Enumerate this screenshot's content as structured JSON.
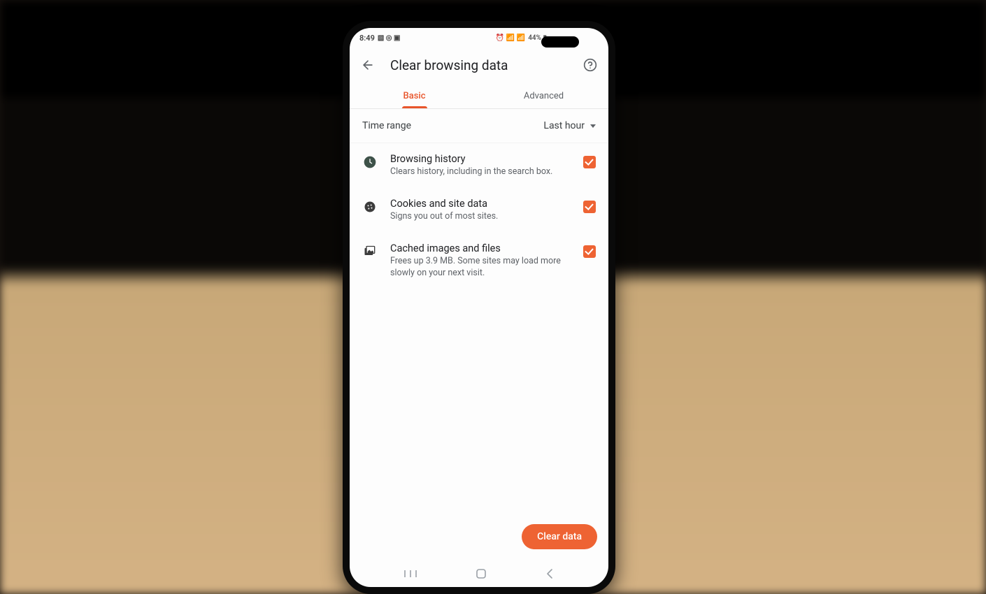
{
  "status": {
    "time": "8:49",
    "left_glyphs": "▧ ◎ ▣",
    "right_glyphs": "⏰ 📶 📶",
    "battery": "44% ▮"
  },
  "appbar": {
    "title": "Clear browsing data"
  },
  "tabs": {
    "basic": "Basic",
    "advanced": "Advanced"
  },
  "time_range": {
    "label": "Time range",
    "value": "Last hour"
  },
  "options": [
    {
      "icon": "clock-icon",
      "title": "Browsing history",
      "sub": "Clears history, including in the search box.",
      "checked": true
    },
    {
      "icon": "cookie-icon",
      "title": "Cookies and site data",
      "sub": "Signs you out of most sites.",
      "checked": true
    },
    {
      "icon": "image-icon",
      "title": "Cached images and files",
      "sub": "Frees up 3.9 MB. Some sites may load more slowly on your next visit.",
      "checked": true
    }
  ],
  "footer": {
    "clear_label": "Clear data"
  }
}
